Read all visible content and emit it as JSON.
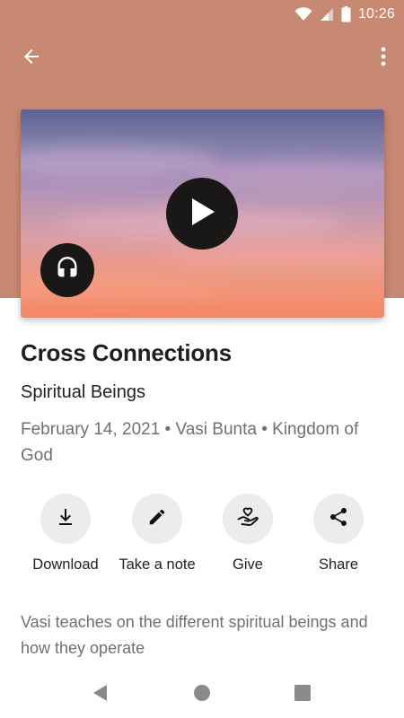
{
  "status_bar": {
    "time": "10:26"
  },
  "icons": {
    "back": "arrow-back-icon",
    "more": "more-vert-icon",
    "play": "play-icon",
    "audio": "headphones-icon",
    "download": "download-icon",
    "note": "pencil-icon",
    "give": "giving-hand-icon",
    "share": "share-icon"
  },
  "colors": {
    "header_background": "#c88973",
    "media_button": "#1a1717",
    "action_circle": "#ececec",
    "title": "#1f1f1f",
    "secondary_text": "#707070"
  },
  "sermon": {
    "title": "Cross Connections",
    "subtitle": "Spiritual Beings",
    "meta": "February 14, 2021 • Vasi Bunta • Kingdom of God",
    "description": "Vasi teaches on the different spiritual beings and how they operate"
  },
  "actions": {
    "download": "Download",
    "note": "Take a note",
    "give": "Give",
    "share": "Share"
  }
}
